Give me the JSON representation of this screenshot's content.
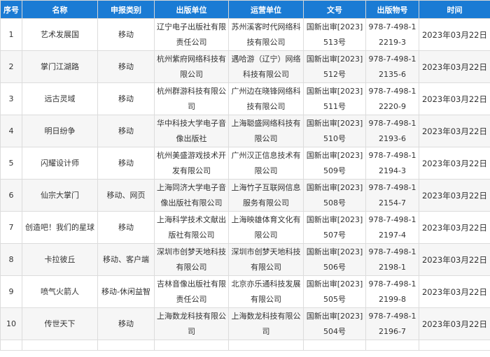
{
  "headers": [
    "序号",
    "名称",
    "申报类别",
    "出版单位",
    "运营单位",
    "文号",
    "出版物号",
    "时间"
  ],
  "rows": [
    {
      "no": "1",
      "name": "艺术发展国",
      "category": "移动",
      "publisher": "辽宁电子出版社有限责任公司",
      "operator": "苏州溪客时代网络科技有限公司",
      "doc": "国新出审[2023]513号",
      "isbn": "978-7-498-12219-3",
      "date": "2023年03月22日"
    },
    {
      "no": "2",
      "name": "掌门江湖路",
      "category": "移动",
      "publisher": "杭州紫府网络科技有限公司",
      "operator": "遇哈游（辽宁）网络科技有限公司",
      "doc": "国新出审[2023]512号",
      "isbn": "978-7-498-12135-6",
      "date": "2023年03月22日"
    },
    {
      "no": "3",
      "name": "远古灵域",
      "category": "移动",
      "publisher": "杭州群游科技有限公司",
      "operator": "广州边在晓锋网络科技有限公司",
      "doc": "国新出审[2023]511号",
      "isbn": "978-7-498-12220-9",
      "date": "2023年03月22日"
    },
    {
      "no": "4",
      "name": "明日纷争",
      "category": "移动",
      "publisher": "华中科技大学电子音像出版社",
      "operator": "上海聪盛网络科技有限公司",
      "doc": "国新出审[2023]510号",
      "isbn": "978-7-498-12193-6",
      "date": "2023年03月22日"
    },
    {
      "no": "5",
      "name": "闪耀设计师",
      "category": "移动",
      "publisher": "杭州美盛游戏技术开发有限公司",
      "operator": "广州汉正信息技术有限公司",
      "doc": "国新出审[2023]509号",
      "isbn": "978-7-498-12194-3",
      "date": "2023年03月22日"
    },
    {
      "no": "6",
      "name": "仙宗大掌门",
      "category": "移动、网页",
      "publisher": "上海同济大学电子音像出版社有限公司",
      "operator": "上海竹子互联网信息服务有限公司",
      "doc": "国新出审[2023]508号",
      "isbn": "978-7-498-12154-7",
      "date": "2023年03月22日"
    },
    {
      "no": "7",
      "name": "创造吧！我们的星球",
      "category": "移动",
      "publisher": "上海科学技术文献出版社有限公司",
      "operator": "上海映雄体育文化有限公司",
      "doc": "国新出审[2023]507号",
      "isbn": "978-7-498-12197-4",
      "date": "2023年03月22日"
    },
    {
      "no": "8",
      "name": "卡拉彼丘",
      "category": "移动、客户端",
      "publisher": "深圳市创梦天地科技有限公司",
      "operator": "深圳市创梦天地科技有限公司",
      "doc": "国新出审[2023]506号",
      "isbn": "978-7-498-12198-1",
      "date": "2023年03月22日"
    },
    {
      "no": "9",
      "name": "喷气火箭人",
      "category": "移动-休闲益智",
      "publisher": "吉林音像出版社有限责任公司",
      "operator": "北京亦乐通科技发展有限公司",
      "doc": "国新出审[2023]505号",
      "isbn": "978-7-498-12199-8",
      "date": "2023年03月22日"
    },
    {
      "no": "10",
      "name": "传世天下",
      "category": "移动",
      "publisher": "上海数龙科技有限公司",
      "operator": "上海数龙科技有限公司",
      "doc": "国新出审[2023]504号",
      "isbn": "978-7-498-12196-7",
      "date": "2023年03月22日"
    }
  ]
}
